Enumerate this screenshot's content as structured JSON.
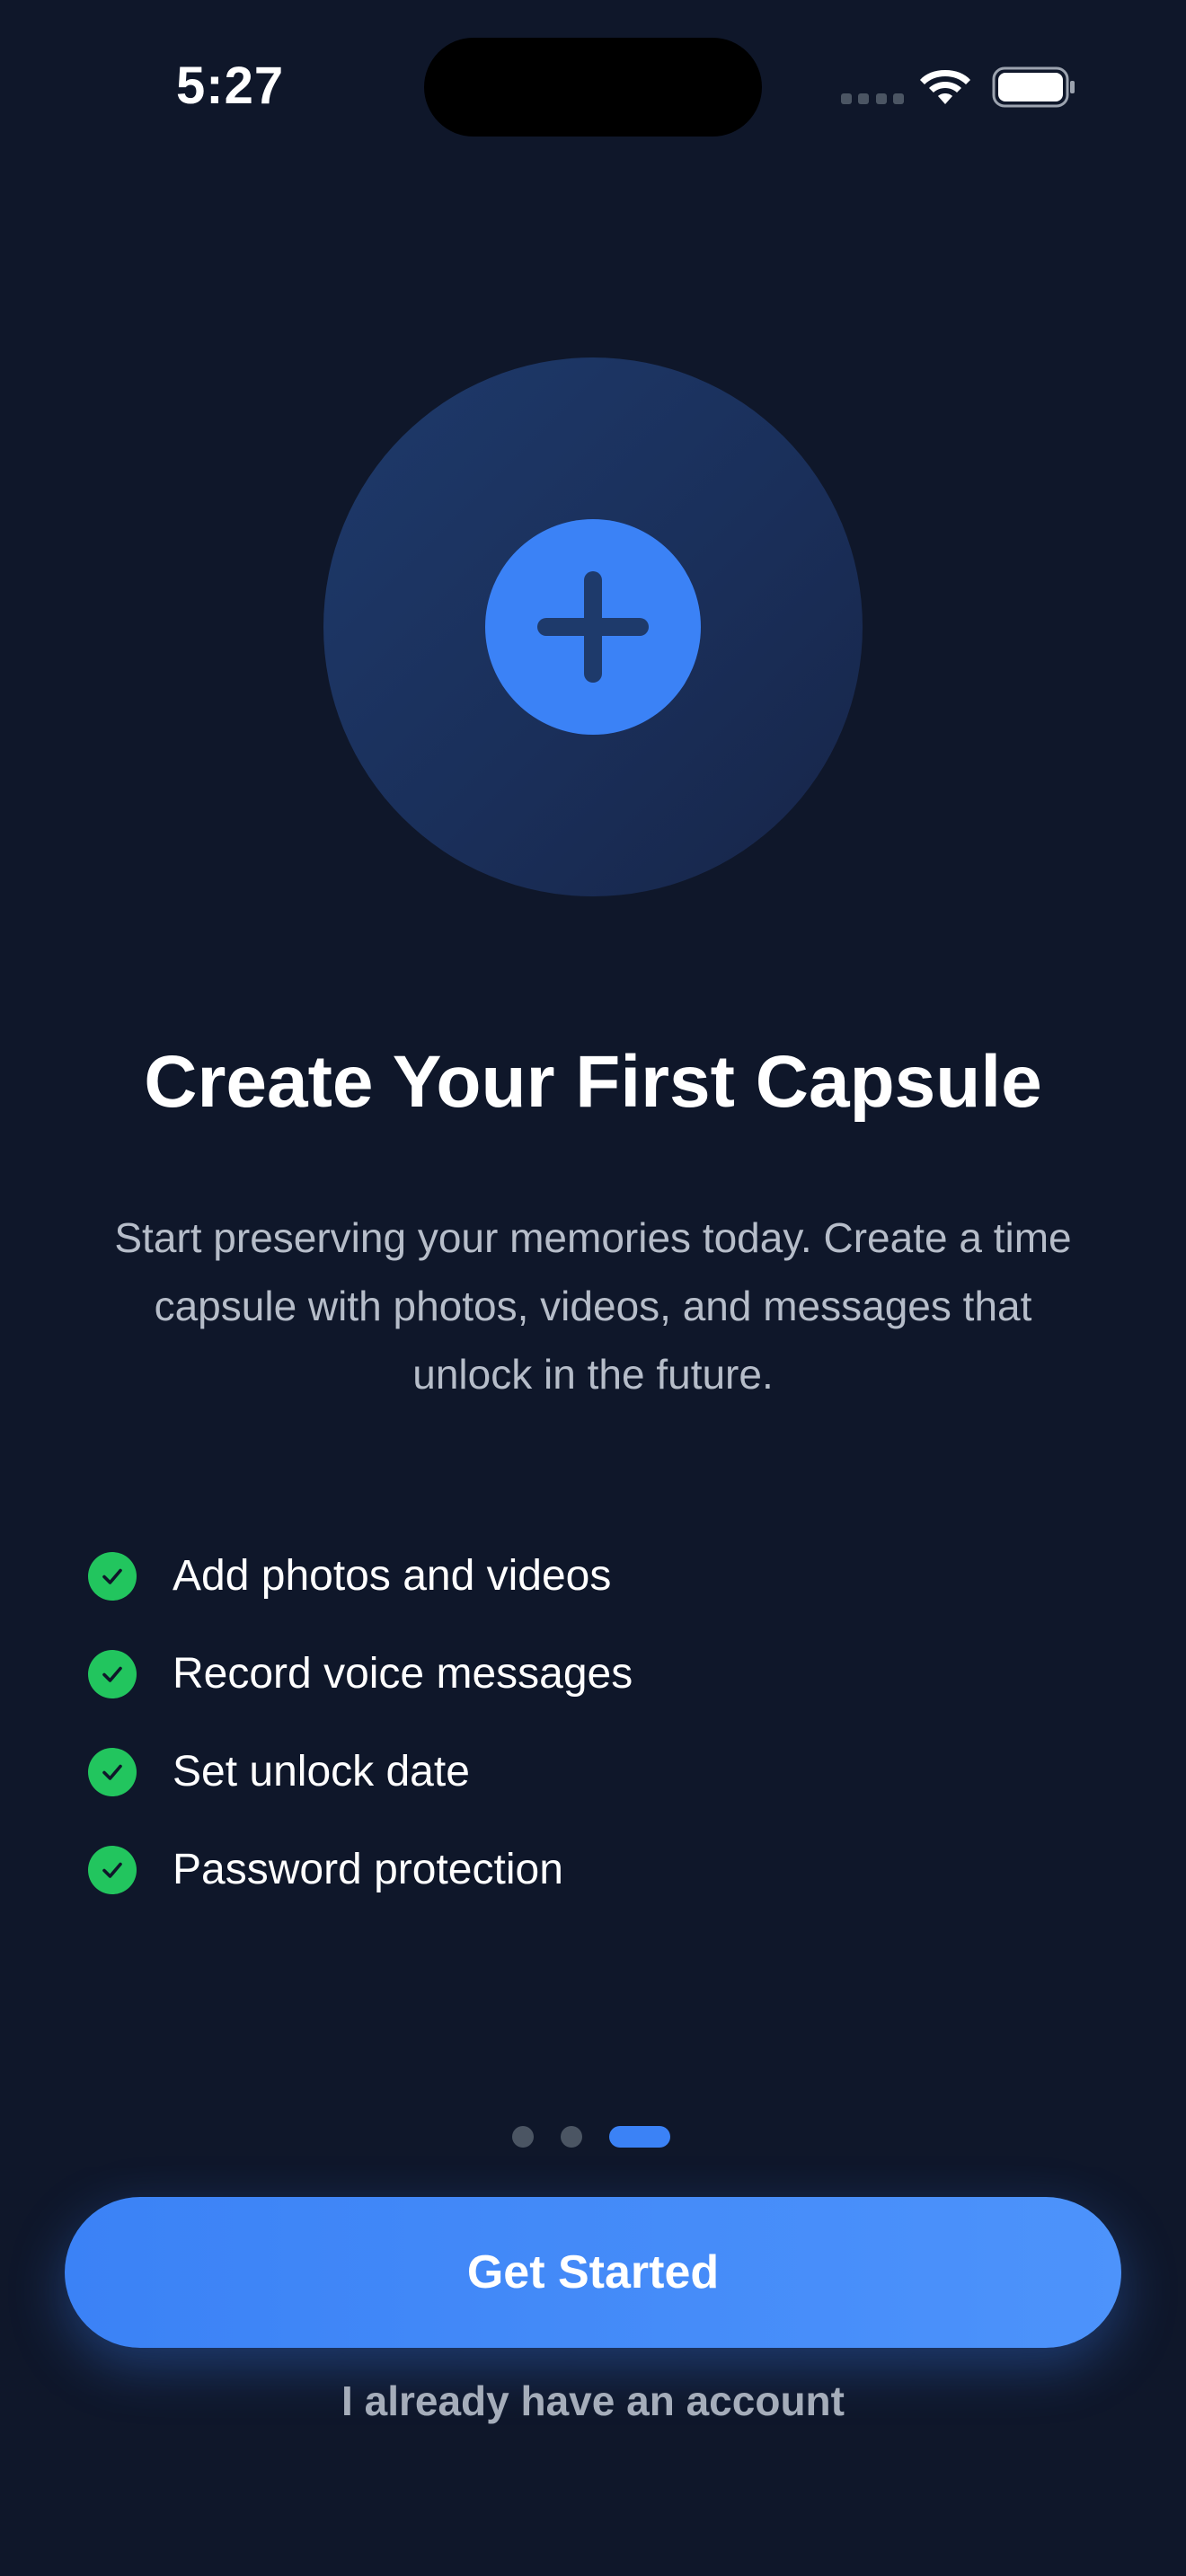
{
  "status_bar": {
    "time": "5:27",
    "signal_icon": "cellular-signal-icon",
    "wifi_icon": "wifi-icon",
    "battery_icon": "battery-icon"
  },
  "hero": {
    "icon": "plus-icon",
    "colors": {
      "outer_circle": "#1e3a6b",
      "inner_circle": "#3b82f6",
      "plus": "#1e3a6b"
    }
  },
  "title": "Create Your First Capsule",
  "subtitle": "Start preserving your memories today. Create a time capsule with photos, videos, and messages that unlock in the future.",
  "features": [
    {
      "icon": "check-circle-icon",
      "label": "Add photos and videos"
    },
    {
      "icon": "check-circle-icon",
      "label": "Record voice messages"
    },
    {
      "icon": "check-circle-icon",
      "label": "Set unlock date"
    },
    {
      "icon": "check-circle-icon",
      "label": "Password protection"
    }
  ],
  "pager": {
    "total_pages": 3,
    "current_page": 3
  },
  "actions": {
    "primary_label": "Get Started",
    "secondary_label": "I already have an account"
  },
  "colors": {
    "background": "#0f172a",
    "accent": "#3b82f6",
    "success": "#22c55e",
    "text_primary": "#ffffff",
    "text_secondary": "#b6bdc9"
  }
}
